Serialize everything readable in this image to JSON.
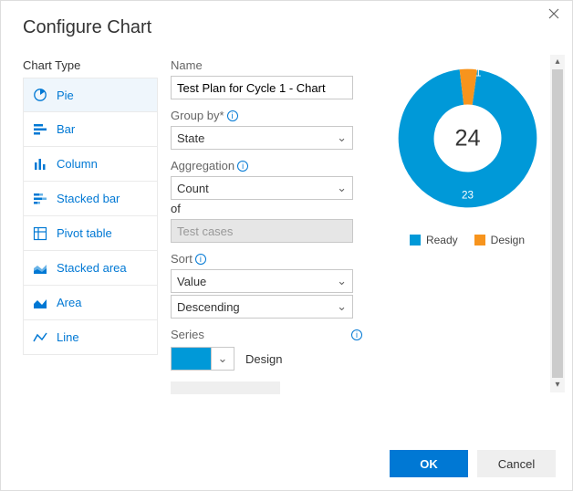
{
  "dialog": {
    "title": "Configure Chart"
  },
  "chart_type_section": {
    "label": "Chart Type",
    "items": [
      {
        "id": "pie",
        "label": "Pie",
        "selected": true
      },
      {
        "id": "bar",
        "label": "Bar",
        "selected": false
      },
      {
        "id": "column",
        "label": "Column",
        "selected": false
      },
      {
        "id": "stacked-bar",
        "label": "Stacked bar",
        "selected": false
      },
      {
        "id": "pivot-table",
        "label": "Pivot table",
        "selected": false
      },
      {
        "id": "stacked-area",
        "label": "Stacked area",
        "selected": false
      },
      {
        "id": "area",
        "label": "Area",
        "selected": false
      },
      {
        "id": "line",
        "label": "Line",
        "selected": false
      }
    ]
  },
  "form": {
    "name_label": "Name",
    "name_value": "Test Plan for Cycle 1 - Chart",
    "group_by_label": "Group by*",
    "group_by_value": "State",
    "aggregation_label": "Aggregation",
    "aggregation_value": "Count",
    "of_label": "of",
    "of_value": "Test cases",
    "sort_label": "Sort",
    "sort_field_value": "Value",
    "sort_dir_value": "Descending",
    "series_label": "Series",
    "series_name": "Design",
    "series_color": "#0099d8"
  },
  "chart_data": {
    "type": "pie",
    "title": "",
    "total": 24,
    "categories": [
      "Ready",
      "Design"
    ],
    "values": [
      23,
      1
    ],
    "series": [
      {
        "name": "Ready",
        "value": 23,
        "color": "#0099d8"
      },
      {
        "name": "Design",
        "value": 1,
        "color": "#f7941d"
      }
    ],
    "legend": [
      "Ready",
      "Design"
    ]
  },
  "footer": {
    "ok": "OK",
    "cancel": "Cancel"
  }
}
